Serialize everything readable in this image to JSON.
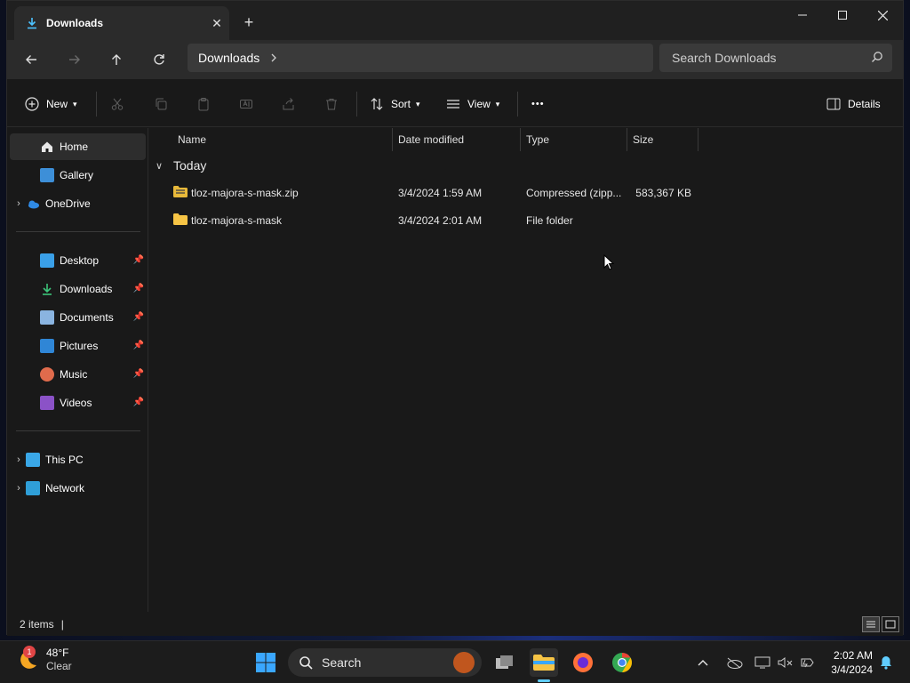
{
  "window": {
    "tab_title": "Downloads",
    "tab_close": "✕",
    "new_tab": "+"
  },
  "address": {
    "path": "Downloads",
    "search_placeholder": "Search Downloads"
  },
  "commands": {
    "new_label": "New",
    "sort_label": "Sort",
    "view_label": "View",
    "more_label": "•••",
    "details_label": "Details"
  },
  "nav": {
    "items": [
      {
        "label": "Home"
      },
      {
        "label": "Gallery"
      },
      {
        "label": "OneDrive"
      },
      {
        "label": "Desktop"
      },
      {
        "label": "Downloads"
      },
      {
        "label": "Documents"
      },
      {
        "label": "Pictures"
      },
      {
        "label": "Music"
      },
      {
        "label": "Videos"
      },
      {
        "label": "This PC"
      },
      {
        "label": "Network"
      }
    ]
  },
  "columns": [
    "Name",
    "Date modified",
    "Type",
    "Size"
  ],
  "group_label": "Today",
  "files": [
    {
      "name": "tloz-majora-s-mask.zip",
      "date": "3/4/2024 1:59 AM",
      "type": "Compressed (zipp...",
      "size": "583,367 KB",
      "icon": "zip-folder-icon"
    },
    {
      "name": "tloz-majora-s-mask",
      "date": "3/4/2024 2:01 AM",
      "type": "File folder",
      "size": "",
      "icon": "folder-icon"
    }
  ],
  "status": {
    "item_count": "2 items"
  },
  "taskbar": {
    "weather_temp": "48°F",
    "weather_cond": "Clear",
    "weather_badge": "1",
    "search_label": "Search",
    "time": "2:02 AM",
    "date": "3/4/2024"
  },
  "colors": {
    "folder": "#f6c445",
    "accent": "#60cdff"
  }
}
